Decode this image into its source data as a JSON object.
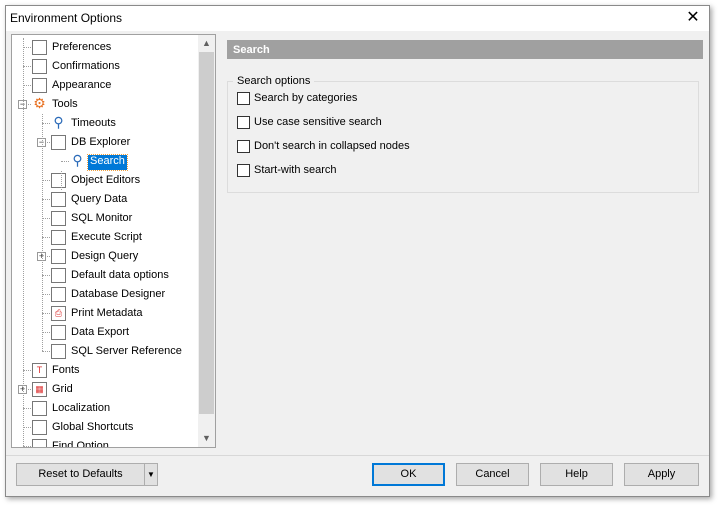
{
  "window": {
    "title": "Environment Options",
    "close_icon": "close-icon"
  },
  "tree": {
    "items": [
      {
        "label": "Preferences",
        "level": 0,
        "icon": "preferences-icon"
      },
      {
        "label": "Confirmations",
        "level": 0,
        "icon": "confirmations-icon"
      },
      {
        "label": "Appearance",
        "level": 0,
        "icon": "appearance-icon"
      },
      {
        "label": "Tools",
        "level": 0,
        "icon": "tools-gear-icon",
        "expanded": true
      },
      {
        "label": "Timeouts",
        "level": 1,
        "icon": "timeouts-icon"
      },
      {
        "label": "DB Explorer",
        "level": 1,
        "icon": "db-explorer-icon",
        "expanded": true
      },
      {
        "label": "Search",
        "level": 2,
        "icon": "search-icon",
        "selected": true
      },
      {
        "label": "Object Editors",
        "level": 1,
        "icon": "object-editors-icon"
      },
      {
        "label": "Query Data",
        "level": 1,
        "icon": "query-data-icon"
      },
      {
        "label": "SQL Monitor",
        "level": 1,
        "icon": "sql-monitor-icon"
      },
      {
        "label": "Execute Script",
        "level": 1,
        "icon": "execute-script-icon"
      },
      {
        "label": "Design Query",
        "level": 1,
        "icon": "design-query-icon",
        "expanded": false
      },
      {
        "label": "Default data options",
        "level": 1,
        "icon": "default-data-options-icon"
      },
      {
        "label": "Database Designer",
        "level": 1,
        "icon": "database-designer-icon"
      },
      {
        "label": "Print Metadata",
        "level": 1,
        "icon": "printer-icon"
      },
      {
        "label": "Data Export",
        "level": 1,
        "icon": "data-export-icon"
      },
      {
        "label": "SQL Server Reference",
        "level": 1,
        "icon": "sql-server-reference-icon"
      },
      {
        "label": "Fonts",
        "level": 0,
        "icon": "fonts-icon"
      },
      {
        "label": "Grid",
        "level": 0,
        "icon": "grid-icon",
        "expanded": false
      },
      {
        "label": "Localization",
        "level": 0,
        "icon": "localization-icon"
      },
      {
        "label": "Global Shortcuts",
        "level": 0,
        "icon": "global-shortcuts-icon"
      },
      {
        "label": "Find Option",
        "level": 0,
        "icon": "find-option-icon"
      }
    ]
  },
  "panel": {
    "header": "Search",
    "group_title": "Search options",
    "options": [
      {
        "label": "Search by categories",
        "checked": false
      },
      {
        "label": "Use case sensitive search",
        "checked": false
      },
      {
        "label": "Don't search in collapsed nodes",
        "checked": false
      },
      {
        "label": "Start-with search",
        "checked": false
      }
    ]
  },
  "buttons": {
    "reset": "Reset to Defaults",
    "ok": "OK",
    "cancel": "Cancel",
    "help": "Help",
    "apply": "Apply"
  },
  "colors": {
    "selection": "#0078d7",
    "header": "#a0a0a0"
  }
}
